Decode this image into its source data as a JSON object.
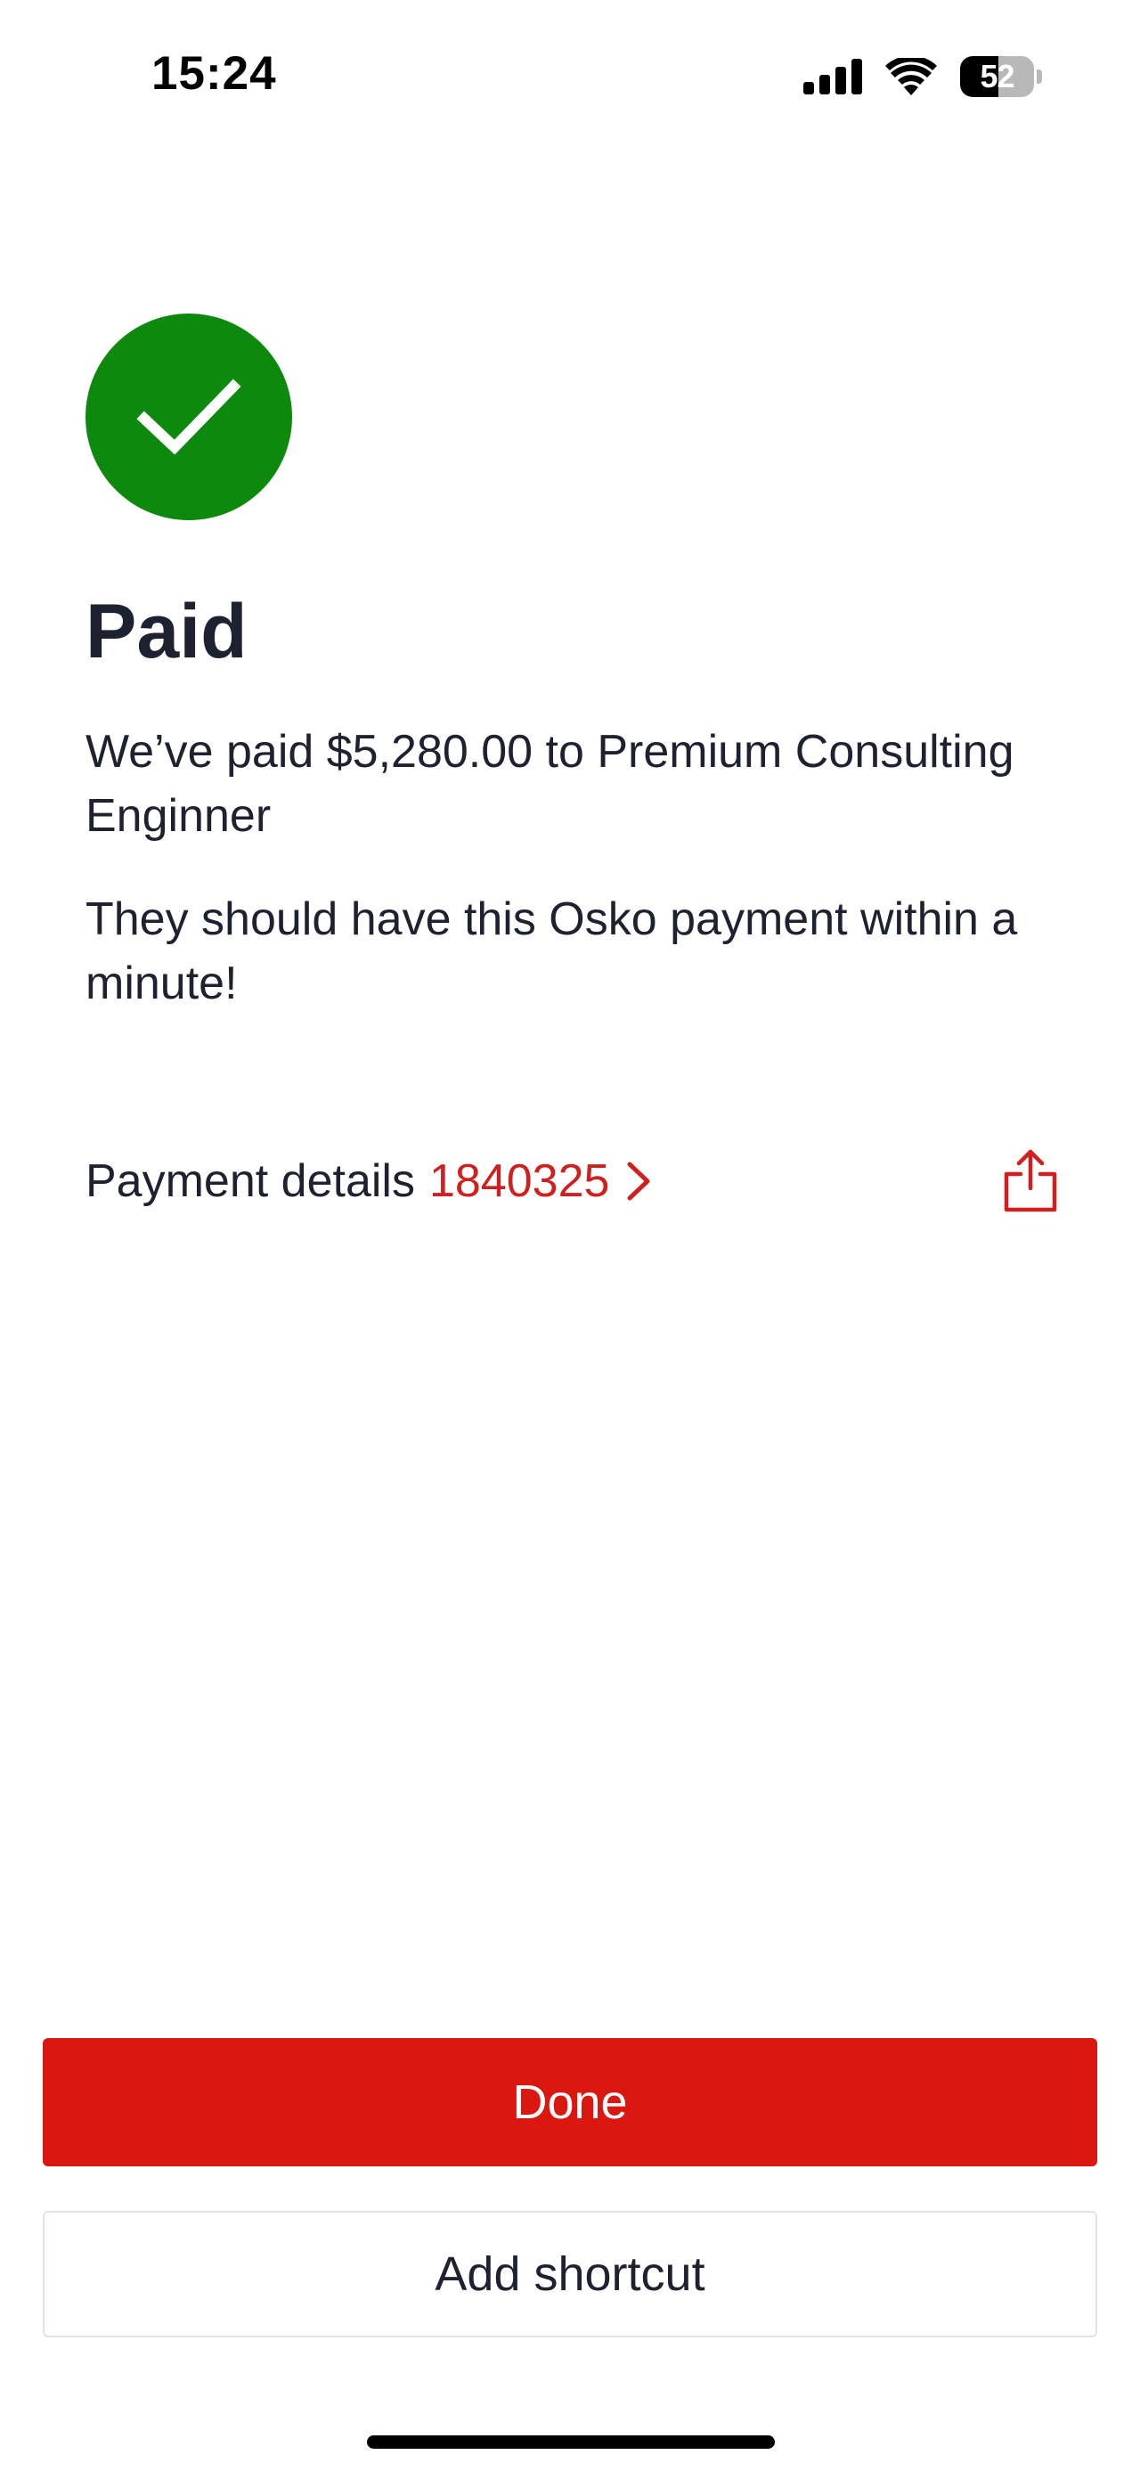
{
  "status_bar": {
    "time": "15:24",
    "battery_level": "52",
    "battery_fraction": 0.52
  },
  "icons": {
    "success": "checkmark-icon",
    "chevron": "chevron-right-icon",
    "share": "share-icon"
  },
  "colors": {
    "success_green": "#0d8a0d",
    "brand_red": "#da1710",
    "link_red": "#d01f1f",
    "text_dark": "#1e2130"
  },
  "confirmation": {
    "title": "Paid",
    "message_primary": "We’ve paid $5,280.00 to Premium Consulting Enginner",
    "message_secondary": "They should have this Osko payment within a minute!"
  },
  "payment_details": {
    "label": "Payment details",
    "reference": "1840325"
  },
  "actions": {
    "done_label": "Done",
    "add_shortcut_label": "Add shortcut"
  }
}
